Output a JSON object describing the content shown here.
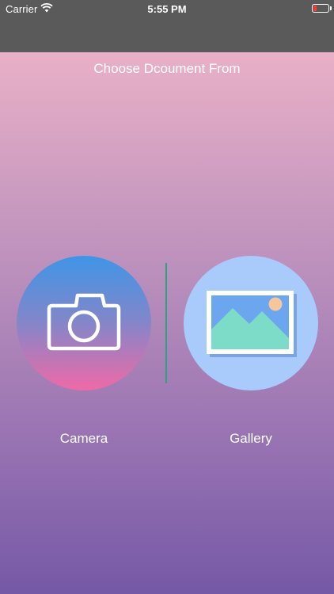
{
  "status_bar": {
    "carrier": "Carrier",
    "time": "5:55 PM",
    "battery_color": "#ff3b30"
  },
  "main": {
    "prompt": "Choose Dcoument From",
    "options": [
      {
        "label": "Camera",
        "icon": "camera-icon"
      },
      {
        "label": "Gallery",
        "icon": "gallery-icon"
      }
    ]
  },
  "colors": {
    "nav_bar": "#5a5a5a",
    "background_top": "#e9b0c7",
    "background_bottom": "#7558a6",
    "divider": "#2aa57a",
    "gallery_circle": "#a9cbfc"
  }
}
